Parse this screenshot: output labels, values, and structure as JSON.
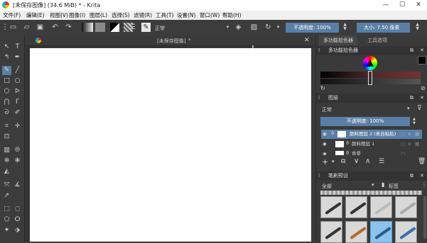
{
  "titlebar": {
    "title": "[未保存图像] (34.6 MiB) * - Krita",
    "minimize": "—",
    "maximize": "☐",
    "close": "✕"
  },
  "menubar": {
    "items": [
      "文件(F)",
      "编辑(E)",
      "视图(V)",
      "图像(I)",
      "图层(L)",
      "选择(S)",
      "滤镜(R)",
      "工具(T)",
      "设置(N)",
      "窗口(W)",
      "帮助(H)"
    ]
  },
  "toolbar": {
    "blend_mode": "正常",
    "opacity": "不透明度: 100%",
    "size": "大小: 7.50 像素"
  },
  "document": {
    "tab_title": "[未保存图像]",
    "tab_marker": "*",
    "close": "✕"
  },
  "docker_tabs": {
    "advanced_color": "多功能拾色器",
    "tool_options": "工具选项"
  },
  "color_panel": {
    "title": "多功能拾色器"
  },
  "layers_panel": {
    "title": "图层",
    "blend_mode": "正常",
    "opacity": "不透明度: 100%",
    "layers": [
      {
        "name": "颜料图层 2 (来自粘贴)"
      },
      {
        "name": "颜料图层 1"
      },
      {
        "name": "背景"
      }
    ]
  },
  "brush_panel": {
    "title": "笔刷预设",
    "filter": "全部",
    "tag_label": "标签"
  },
  "colors": {
    "accent": "#5a7fa7",
    "panel": "#3a3a3a"
  }
}
